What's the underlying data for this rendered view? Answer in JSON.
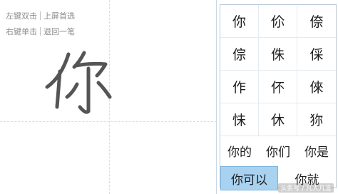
{
  "pad": {
    "hint1_label": "左键双击",
    "hint1_action": "上屏首选",
    "hint2_label": "右键单击",
    "hint2_action": "退回一笔"
  },
  "candidates": {
    "chars": [
      "你",
      "伱",
      "倷",
      "倧",
      "侏",
      "倸",
      "作",
      "伓",
      "倈",
      "怽",
      "休",
      "狝"
    ],
    "phrases": [
      "你的",
      "你们",
      "你是"
    ],
    "bottom": [
      "你可以",
      "你就"
    ],
    "selected_index": 0,
    "selected_color": "#a9d2f0"
  },
  "watermark": "头条号 / 凡人凡言"
}
